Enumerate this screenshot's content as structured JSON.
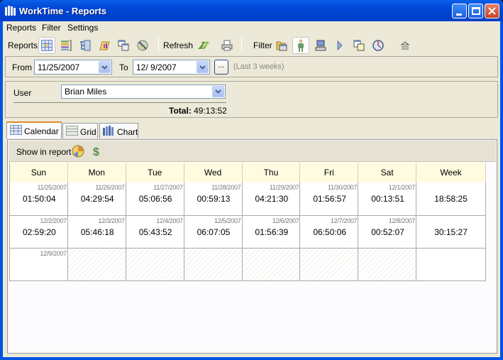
{
  "window": {
    "title": "WorkTime - Reports",
    "accent": "#0054e3"
  },
  "menu": [
    {
      "label": "Reports",
      "accel": "R"
    },
    {
      "label": "Filter",
      "accel": "F"
    },
    {
      "label": "Settings",
      "accel": "S"
    }
  ],
  "toolbar": {
    "reports_label": "Reports",
    "report_icons": [
      "calendar-report-icon",
      "grid-report-icon",
      "tree-report-icon",
      "chart-report-icon",
      "windows-report-icon",
      "globe-report-icon"
    ],
    "refresh_label": "Refresh",
    "filter_label": "Filter",
    "filter_icons": [
      "folder-window-icon",
      "user-icon",
      "computer-icon",
      "play-icon",
      "documents-icon",
      "clock-icon",
      "eject-icon"
    ]
  },
  "date_filter": {
    "from_label": "From",
    "from_value": "11/25/2007",
    "to_label": "To",
    "to_value": "12/ 9/2007",
    "more_button": "...",
    "range_hint": "(Last 3 weeks)"
  },
  "user_filter": {
    "label": "User",
    "value": "Brian Miles",
    "total_label": "Total:",
    "total_value": "49:13:52"
  },
  "tabs": [
    {
      "label": "Calendar",
      "active": true
    },
    {
      "label": "Grid",
      "active": false
    },
    {
      "label": "Chart",
      "active": false
    }
  ],
  "show_in_report": {
    "label": "Show in report"
  },
  "calendar": {
    "headers": [
      "Sun",
      "Mon",
      "Tue",
      "Wed",
      "Thu",
      "Fri",
      "Sat",
      "Week"
    ],
    "weeks": [
      {
        "days": [
          {
            "date": "11/25/2007",
            "time": "01:50:04"
          },
          {
            "date": "11/26/2007",
            "time": "04:29:54"
          },
          {
            "date": "11/27/2007",
            "time": "05:06:56"
          },
          {
            "date": "11/28/2007",
            "time": "00:59:13"
          },
          {
            "date": "11/29/2007",
            "time": "04:21:30"
          },
          {
            "date": "11/30/2007",
            "time": "01:56:57"
          },
          {
            "date": "12/1/2007",
            "time": "00:13:51"
          }
        ],
        "week_total": "18:58:25"
      },
      {
        "days": [
          {
            "date": "12/2/2007",
            "time": "02:59:20"
          },
          {
            "date": "12/3/2007",
            "time": "05:46:18"
          },
          {
            "date": "12/4/2007",
            "time": "05:43:52"
          },
          {
            "date": "12/5/2007",
            "time": "06:07:05"
          },
          {
            "date": "12/6/2007",
            "time": "01:56:39"
          },
          {
            "date": "12/7/2007",
            "time": "06:50:06"
          },
          {
            "date": "12/8/2007",
            "time": "00:52:07"
          }
        ],
        "week_total": "30:15:27"
      },
      {
        "days": [
          {
            "date": "12/9/2007",
            "time": ""
          },
          {
            "date": "",
            "time": ""
          },
          {
            "date": "",
            "time": ""
          },
          {
            "date": "",
            "time": ""
          },
          {
            "date": "",
            "time": ""
          },
          {
            "date": "",
            "time": ""
          },
          {
            "date": "",
            "time": ""
          }
        ],
        "week_total": ""
      }
    ]
  }
}
